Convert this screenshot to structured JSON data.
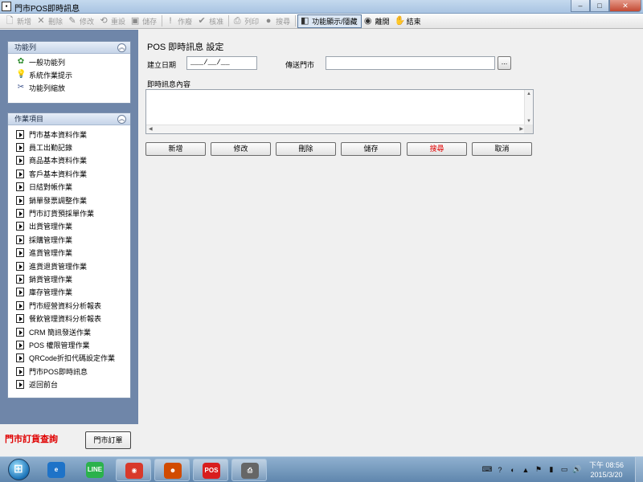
{
  "window": {
    "title": "門市POS即時訊息",
    "minimize": "–",
    "maximize": "□",
    "close": "✕"
  },
  "toolbar": {
    "items": [
      {
        "label": "新增",
        "icon": "new-icon",
        "glyph": "🗋",
        "enabled": false
      },
      {
        "label": "刪除",
        "icon": "delete-icon",
        "glyph": "✕",
        "enabled": false
      },
      {
        "label": "修改",
        "icon": "edit-icon",
        "glyph": "✎",
        "enabled": false
      },
      {
        "label": "重設",
        "icon": "reset-icon",
        "glyph": "⟲",
        "enabled": false
      },
      {
        "label": "儲存",
        "icon": "save-icon",
        "glyph": "▣",
        "enabled": false
      },
      {
        "label": "作廢",
        "icon": "void-icon",
        "glyph": "!",
        "enabled": false
      },
      {
        "label": "核准",
        "icon": "approve-icon",
        "glyph": "✔",
        "enabled": false
      },
      {
        "label": "列印",
        "icon": "print-icon",
        "glyph": "⎙",
        "enabled": false
      },
      {
        "label": "搜尋",
        "icon": "search-icon",
        "glyph": "●",
        "enabled": false
      },
      {
        "label": "功能顯示/隱藏",
        "icon": "toggle-panel-icon",
        "glyph": "◧",
        "enabled": true
      },
      {
        "label": "離開",
        "icon": "exit-icon",
        "glyph": "◉",
        "enabled": true
      },
      {
        "label": "結束",
        "icon": "end-icon",
        "glyph": "✋",
        "enabled": true
      }
    ]
  },
  "function_panel": {
    "header": "功能列",
    "collapse_glyph": "︽",
    "items": [
      {
        "label": "一般功能列",
        "icon": "gear-icon",
        "glyph": "✿",
        "color": "#2a8a2a"
      },
      {
        "label": "系統作業提示",
        "icon": "lightbulb-icon",
        "glyph": "💡",
        "color": "#c9a100"
      },
      {
        "label": "功能列縮放",
        "icon": "tools-icon",
        "glyph": "✂",
        "color": "#3a4f8a"
      }
    ]
  },
  "task_panel": {
    "header": "作業項目",
    "collapse_glyph": "︽",
    "items": [
      "門市基本資料作業",
      "員工出勤記錄",
      "商品基本資料作業",
      "客戶基本資料作業",
      "日結對帳作業",
      "銷單發票調整作業",
      "門市訂貨預採單作業",
      "出貨管理作業",
      "採購管理作業",
      "進貨管理作業",
      "進貨退貨管理作業",
      "銷貨管理作業",
      "庫存管理作業",
      "門市經營資料分析報表",
      "餐飲管理資料分析報表",
      "CRM 簡訊發送作業",
      "POS 權限管理作業",
      "QRCode折扣代碼設定作業",
      "門市POS即時訊息",
      "返回前台"
    ]
  },
  "bottom_left": {
    "order_query": "門市訂貨查詢",
    "order_button": "門市訂單"
  },
  "form": {
    "title": "POS 即時訊息 設定",
    "date_label": "建立日期",
    "date_value": "___/__/__",
    "store_label": "傳送門市",
    "store_value": "",
    "lookup_button": "...",
    "content_label": "即時訊息內容",
    "content_value": ""
  },
  "buttons": [
    {
      "label": "新增",
      "red": false
    },
    {
      "label": "修改",
      "red": false
    },
    {
      "label": "刪除",
      "red": false
    },
    {
      "label": "儲存",
      "red": false
    },
    {
      "label": "搜尋",
      "red": true
    },
    {
      "label": "取消",
      "red": false
    }
  ],
  "taskbar": {
    "apps": [
      {
        "name": "ie",
        "glyph": "e",
        "color": "#1e73c8",
        "open": false
      },
      {
        "name": "line",
        "glyph": "LINE",
        "color": "#2bb24c",
        "open": false
      },
      {
        "name": "chrome",
        "glyph": "◉",
        "color": "#d8392b",
        "open": true
      },
      {
        "name": "app-orange",
        "glyph": "☻",
        "color": "#d14b00",
        "open": true
      },
      {
        "name": "pos",
        "glyph": "POS",
        "color": "#d81e1e",
        "open": true
      },
      {
        "name": "printer",
        "glyph": "⎙",
        "color": "#666666",
        "open": true
      }
    ],
    "time": "下午 08:56",
    "date": "2015/3/20"
  }
}
